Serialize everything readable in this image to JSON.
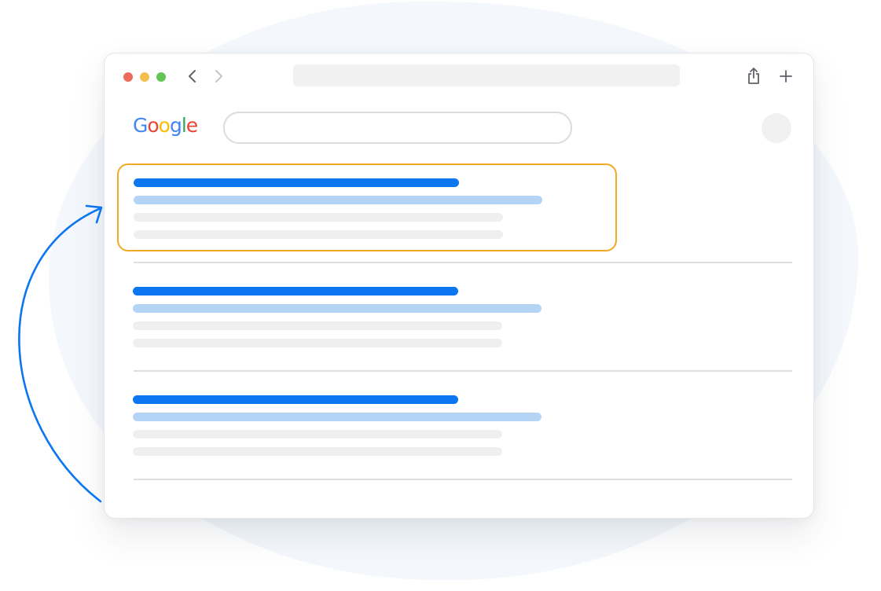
{
  "browser": {
    "window_controls": [
      "close",
      "minimize",
      "maximize"
    ],
    "control_colors": {
      "close": "#ed6a5e",
      "minimize": "#f5bf4f",
      "maximize": "#62c554"
    },
    "nav": {
      "back_icon": "chevron-left-icon",
      "forward_icon": "chevron-right-icon"
    },
    "address_bar_value": "",
    "actions": {
      "share_icon": "share-icon",
      "new_tab_icon": "plus-icon"
    }
  },
  "search_page": {
    "logo_text": "Google",
    "logo_letters": [
      {
        "char": "G",
        "color": "#4285f4"
      },
      {
        "char": "o",
        "color": "#ea4335"
      },
      {
        "char": "o",
        "color": "#fbbc05"
      },
      {
        "char": "g",
        "color": "#4285f4"
      },
      {
        "char": "l",
        "color": "#34a853"
      },
      {
        "char": "e",
        "color": "#ea4335"
      }
    ],
    "search_input_value": "",
    "results": [
      {
        "highlighted": true
      },
      {
        "highlighted": false
      },
      {
        "highlighted": false
      }
    ]
  },
  "colors": {
    "result_title": "#0b76f0",
    "result_url": "#b4d4f6",
    "snippet": "#efefef",
    "highlight_border": "#f2a923",
    "arrow": "#0b76f0",
    "background_blob": "#f4f8fc"
  },
  "annotation": {
    "arrow_icon": "curved-arrow-icon",
    "points_to": "result-1"
  }
}
